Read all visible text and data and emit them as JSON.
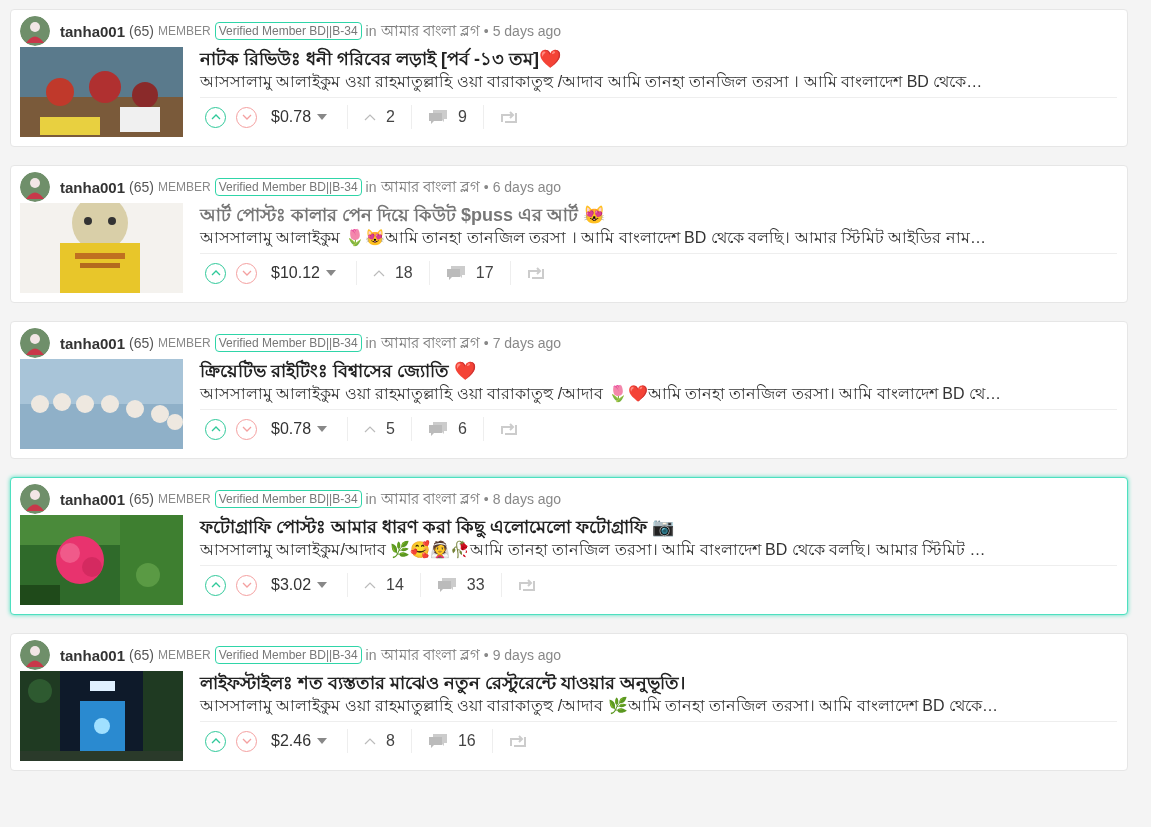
{
  "posts": [
    {
      "author": "tanha001",
      "reputation": "(65)",
      "role": "MEMBER",
      "badge": "Verified Member BD||B-34",
      "in": "in",
      "community": "আমার বাংলা ব্লগ",
      "age": "• 5 days ago",
      "title": "নাটক রিভিউঃ ধনী গরিবের লড়াই [পর্ব -১৩ তম]❤️",
      "visited": false,
      "highlighted": false,
      "excerpt": "আসসালামু আলাইকুম ওয়া রাহমাতুল্লাহি ওয়া বারাকাতুহু /আদাব আমি তানহা তানজিল তরসা । আমি বাংলাদেশ BD থেকে…",
      "payout": "$0.78",
      "votes": "2",
      "comments": "9"
    },
    {
      "author": "tanha001",
      "reputation": "(65)",
      "role": "MEMBER",
      "badge": "Verified Member BD||B-34",
      "in": "in",
      "community": "আমার বাংলা ব্লগ",
      "age": "• 6 days ago",
      "title": "আর্ট পোস্টঃ কালার পেন দিয়ে কিউট $puss এর আর্ট 😻",
      "visited": true,
      "highlighted": false,
      "excerpt": "আসসালামু আলাইকুম 🌷😻আমি তানহা তানজিল তরসা । আমি বাংলাদেশ BD থেকে বলছি। আমার স্টিমিট আইডির নাম…",
      "payout": "$10.12",
      "votes": "18",
      "comments": "17"
    },
    {
      "author": "tanha001",
      "reputation": "(65)",
      "role": "MEMBER",
      "badge": "Verified Member BD||B-34",
      "in": "in",
      "community": "আমার বাংলা ব্লগ",
      "age": "• 7 days ago",
      "title": "ক্রিয়েটিভ রাইটিংঃ বিশ্বাসের জ্যোতি ❤️",
      "visited": false,
      "highlighted": false,
      "excerpt": "আসসালামু আলাইকুম ওয়া রাহমাতুল্লাহি ওয়া বারাকাতুহু /আদাব 🌷❤️আমি তানহা তানজিল তরসা। আমি বাংলাদেশ BD থে…",
      "payout": "$0.78",
      "votes": "5",
      "comments": "6"
    },
    {
      "author": "tanha001",
      "reputation": "(65)",
      "role": "MEMBER",
      "badge": "Verified Member BD||B-34",
      "in": "in",
      "community": "আমার বাংলা ব্লগ",
      "age": "• 8 days ago",
      "title": "ফটোগ্রাফি পোস্টঃ আমার ধারণ করা কিছু এলোমেলো ফটোগ্রাফি 📷",
      "visited": false,
      "highlighted": true,
      "excerpt": "আসসালামু আলাইকুম/আদাব 🌿🥰👰🥀আমি তানহা তানজিল তরসা। আমি বাংলাদেশ BD থেকে বলছি। আমার স্টিমিট …",
      "payout": "$3.02",
      "votes": "14",
      "comments": "33"
    },
    {
      "author": "tanha001",
      "reputation": "(65)",
      "role": "MEMBER",
      "badge": "Verified Member BD||B-34",
      "in": "in",
      "community": "আমার বাংলা ব্লগ",
      "age": "• 9 days ago",
      "title": "লাইফস্টাইলঃ শত ব্যস্ততার মাঝেও নতুন রেস্টুরেন্টে যাওয়ার অনুভূতি।",
      "visited": false,
      "highlighted": false,
      "excerpt": "আসসালামু আলাইকুম ওয়া রাহমাতুল্লাহি ওয়া বারাকাতুহু /আদাব 🌿আমি তানহা তানজিল তরসা। আমি বাংলাদেশ BD থেকে…",
      "payout": "$2.46",
      "votes": "8",
      "comments": "16"
    }
  ]
}
